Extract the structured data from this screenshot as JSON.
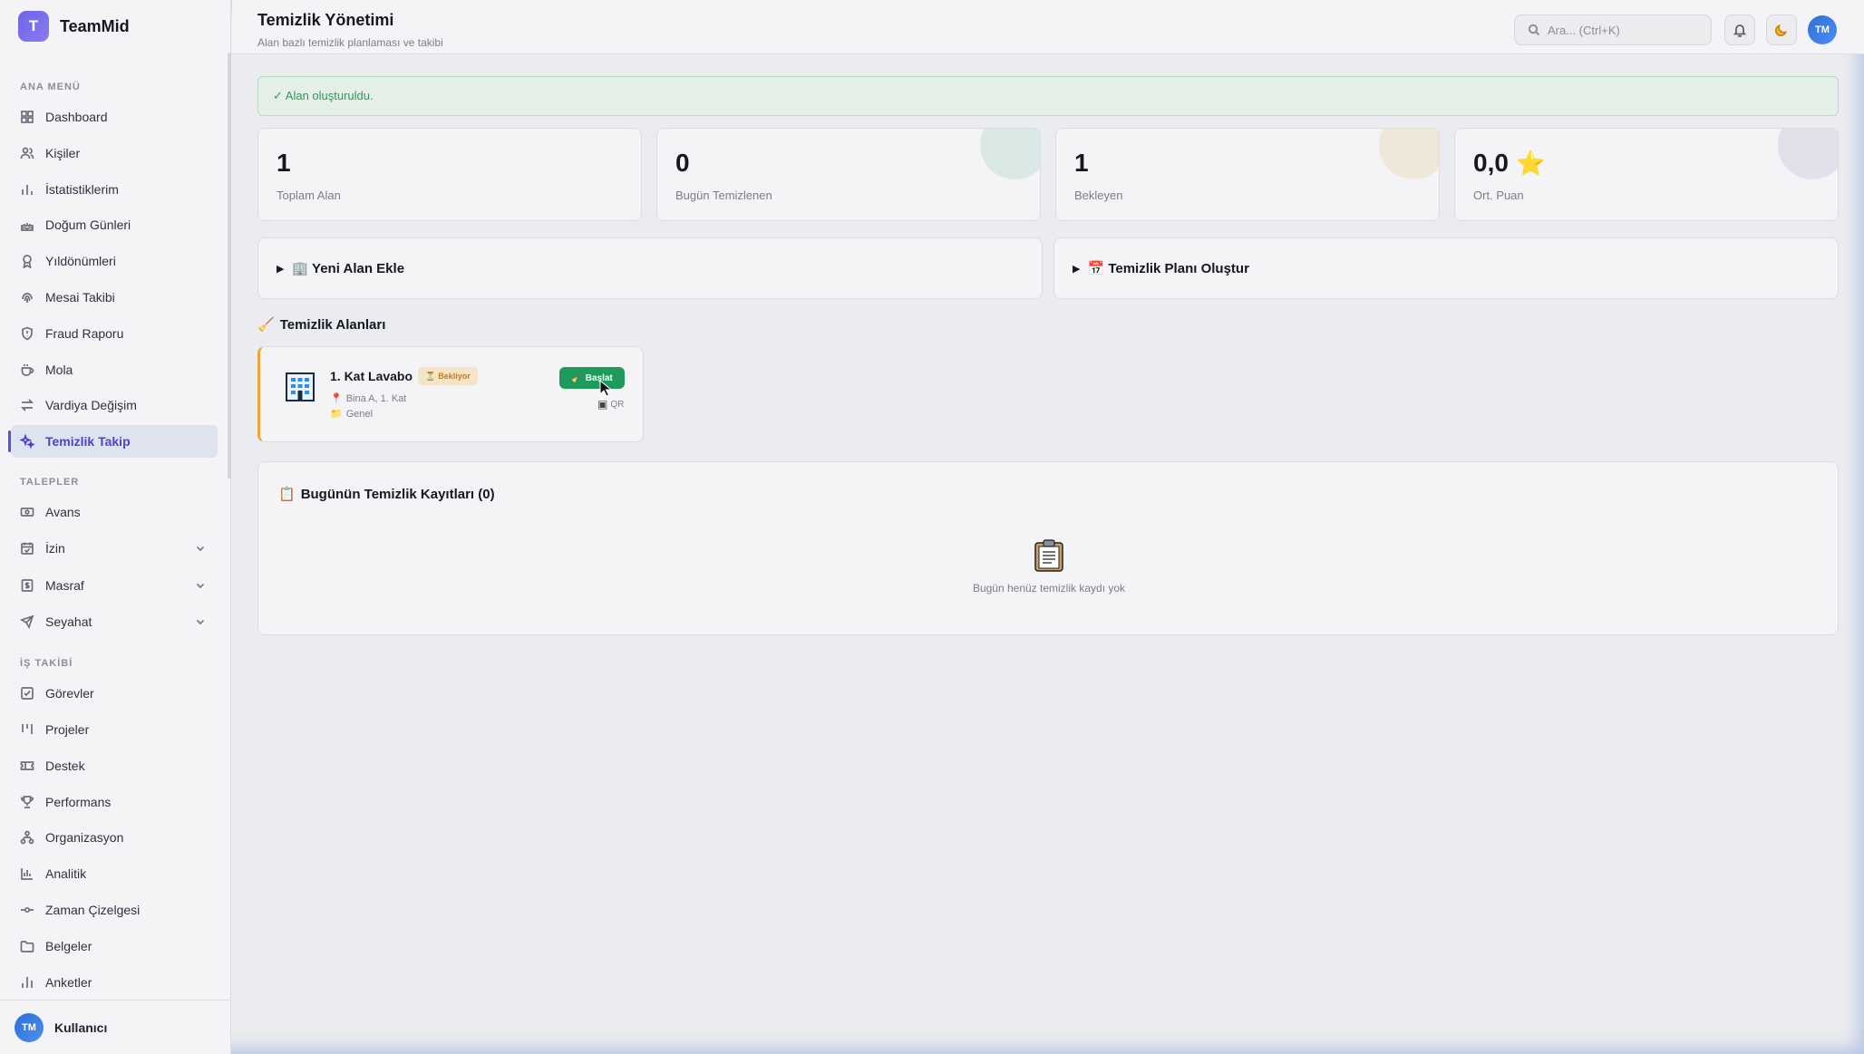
{
  "brand": {
    "logo_letter": "T",
    "name": "TeamMid"
  },
  "sidebar": {
    "section_main": "ANA MENÜ",
    "section_requests": "TALEPLER",
    "section_work": "İŞ TAKİBİ",
    "items": [
      {
        "label": "Dashboard",
        "icon": "grid-icon"
      },
      {
        "label": "Kişiler",
        "icon": "users-icon"
      },
      {
        "label": "İstatistiklerim",
        "icon": "bar-chart-icon"
      },
      {
        "label": "Doğum Günleri",
        "icon": "cake-icon"
      },
      {
        "label": "Yıldönümleri",
        "icon": "award-icon"
      },
      {
        "label": "Mesai Takibi",
        "icon": "fingerprint-icon"
      },
      {
        "label": "Fraud Raporu",
        "icon": "shield-icon"
      },
      {
        "label": "Mola",
        "icon": "coffee-icon"
      },
      {
        "label": "Vardiya Değişim",
        "icon": "swap-icon"
      },
      {
        "label": "Temizlik Takip",
        "icon": "sparkles-icon"
      },
      {
        "label": "Avans",
        "icon": "cash-icon"
      },
      {
        "label": "İzin",
        "icon": "calendar-check-icon"
      },
      {
        "label": "Masraf",
        "icon": "receipt-icon"
      },
      {
        "label": "Seyahat",
        "icon": "plane-icon"
      },
      {
        "label": "Görevler",
        "icon": "check-square-icon"
      },
      {
        "label": "Projeler",
        "icon": "kanban-icon"
      },
      {
        "label": "Destek",
        "icon": "ticket-icon"
      },
      {
        "label": "Performans",
        "icon": "trophy-icon"
      },
      {
        "label": "Organizasyon",
        "icon": "org-chart-icon"
      },
      {
        "label": "Analitik",
        "icon": "analytics-icon"
      },
      {
        "label": "Zaman Çizelgesi",
        "icon": "timeline-icon"
      },
      {
        "label": "Belgeler",
        "icon": "folder-icon"
      },
      {
        "label": "Anketler",
        "icon": "poll-icon"
      }
    ],
    "user": {
      "initials": "TM",
      "name": "Kullanıcı"
    }
  },
  "header": {
    "title": "Temizlik Yönetimi",
    "subtitle": "Alan bazlı temizlik planlaması ve takibi",
    "search_placeholder": "Ara... (Ctrl+K)",
    "avatar_initials": "TM"
  },
  "alert": {
    "text": "✓ Alan oluşturuldu."
  },
  "stats": [
    {
      "value": "1",
      "label": "Toplam Alan"
    },
    {
      "value": "0",
      "label": "Bugün Temizlenen"
    },
    {
      "value": "1",
      "label": "Bekleyen"
    },
    {
      "value": "0,0",
      "label": "Ort. Puan",
      "icon": "⭐"
    }
  ],
  "panels": {
    "add_area": "🏢 Yeni Alan Ekle",
    "create_plan": "📅 Temizlik Planı Oluştur"
  },
  "areas": {
    "title": "Temizlik Alanları",
    "title_icon": "🧹",
    "items": [
      {
        "name": "1. Kat Lavabo",
        "status": "Bekliyor",
        "status_icon": "⏳",
        "location": "Bina A, 1. Kat",
        "location_icon": "📍",
        "category": "Genel",
        "category_icon": "📁",
        "start_label": "Başlat",
        "start_icon": "🧹",
        "qr_label": "QR",
        "qr_icon": "▣"
      }
    ]
  },
  "logs": {
    "title": "Bugünün Temizlik Kayıtları (0)",
    "title_icon": "📋",
    "empty_text": "Bugün henüz temizlik kaydı yok"
  },
  "colors": {
    "accent": "#5a52d6",
    "success": "#1e9a5c",
    "warning": "#f0a13a"
  }
}
